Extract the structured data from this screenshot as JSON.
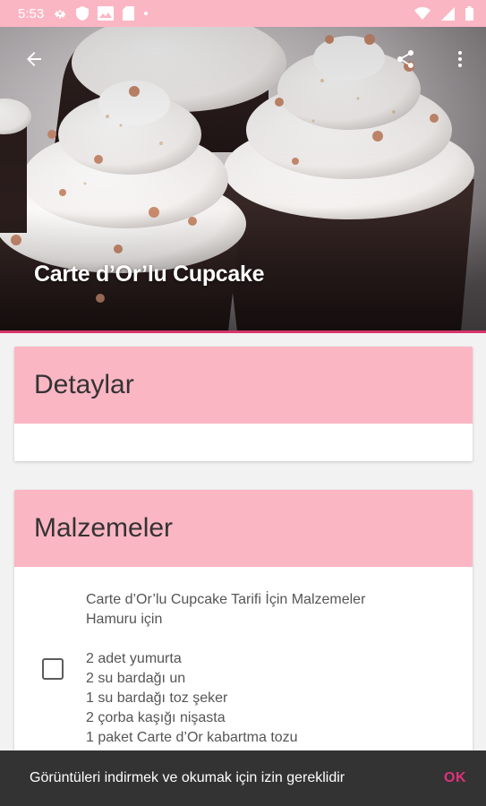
{
  "status_bar": {
    "time": "5:53",
    "icons": [
      "settings-gear-icon",
      "shield-icon",
      "image-icon",
      "sd-card-icon",
      "dot-icon",
      "wifi-icon",
      "signal-icon",
      "battery-icon"
    ],
    "background": "#fbb6c4"
  },
  "toolbar": {
    "back_icon": "arrow-back-icon",
    "share_icon": "share-icon",
    "menu_icon": "more-vert-icon"
  },
  "hero": {
    "title": "Carte d’Or’lu Cupcake",
    "image": "cupcakes-photo",
    "accent_line": "#d8356d"
  },
  "details_card": {
    "title": "Detaylar"
  },
  "ingredients_card": {
    "title": "Malzemeler",
    "lines": [
      "Carte d’Or’lu Cupcake Tarifi İçin Malzemeler",
      "Hamuru için",
      "",
      "2 adet yumurta",
      "2 su bardağı un",
      "1 su bardağı toz şeker",
      "2 çorba kaşığı nişasta",
      "1 paket Carte d’Or kabartma tozu"
    ]
  },
  "snackbar": {
    "message": "Görüntüleri indirmek ve okumak için izin gereklidir",
    "action": "OK",
    "action_color": "#e0307a"
  },
  "colors": {
    "header_pink": "#fbb6c4",
    "accent": "#d8356d",
    "page_bg": "#f2f2f2"
  }
}
